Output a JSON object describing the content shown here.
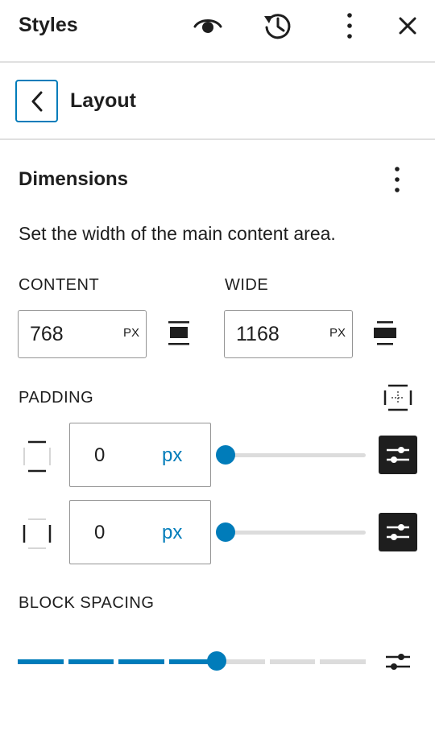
{
  "header": {
    "title": "Styles",
    "icons": [
      "eye-icon",
      "history-icon",
      "more-vertical-icon",
      "close-icon"
    ]
  },
  "subheader": {
    "back_icon": "chevron-left-icon",
    "title": "Layout"
  },
  "dimensions": {
    "title": "Dimensions",
    "description": "Set the width of the main content area.",
    "content": {
      "label": "CONTENT",
      "value": "768",
      "unit": "PX"
    },
    "wide": {
      "label": "WIDE",
      "value": "1168",
      "unit": "PX"
    }
  },
  "padding": {
    "label": "PADDING",
    "vertical": {
      "value": "0",
      "unit": "px",
      "slider_fraction": 0
    },
    "horizontal": {
      "value": "0",
      "unit": "px",
      "slider_fraction": 0
    }
  },
  "block_spacing": {
    "label": "BLOCK SPACING",
    "step_count": 7,
    "selected_step": 4
  },
  "colors": {
    "accent": "#007cba",
    "text": "#1e1e1e",
    "border": "#949494",
    "divider": "#e0e0e0",
    "track": "#dcdcdc"
  }
}
